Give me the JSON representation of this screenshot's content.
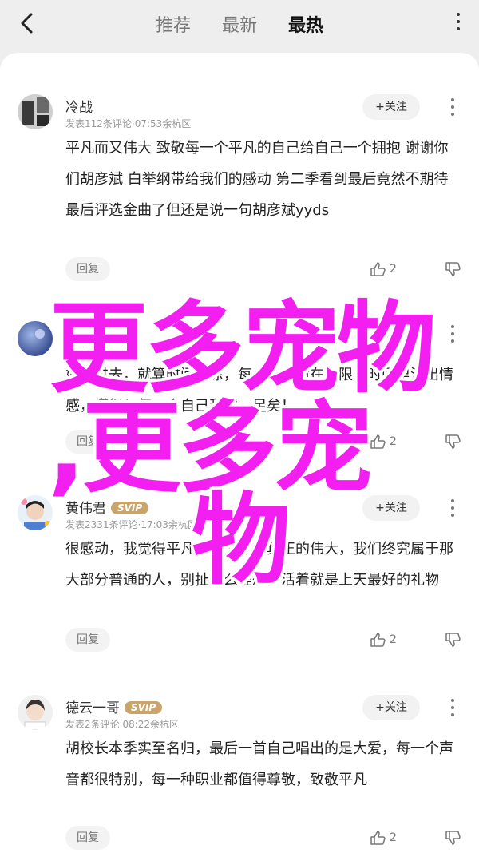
{
  "header": {
    "tabs": [
      {
        "label": "推荐"
      },
      {
        "label": "最新"
      },
      {
        "label": "最热"
      }
    ]
  },
  "comments": [
    {
      "name": "冷战",
      "vip": "",
      "meta": "发表112条评论·07:53余杭区",
      "follow": "+关注",
      "text": "平凡而又伟大  致敬每一个平凡的自己给自己一个拥抱 谢谢你们胡彦斌 白举纲带给我们的感动 第二季看到最后竟然不期待最后评选金曲了但还是说一句胡彦斌yyds",
      "reply": "回复",
      "likes": "2"
    },
    {
      "name": "",
      "vip": "",
      "meta": "发表",
      "follow": "+关注",
      "text": "如果过去，就算时间薄凉，每一个生命在有限的时间里活出情感，懂得与每一个自己和解～足矣！",
      "reply": "回复",
      "likes": "2"
    },
    {
      "name": "黄伟君",
      "vip": "SVIP",
      "meta": "发表2331条评论·17:03余杭区",
      "follow": "+关注",
      "text": "很感动，我觉得平凡的伟大才是真正的伟大，我们终究属于那大部分普通的人，别扯什么理想，活着就是上天最好的礼物",
      "reply": "回复",
      "likes": "2"
    },
    {
      "name": "德云一哥",
      "vip": "SVIP",
      "meta": "发表2条评论·08:22余杭区",
      "follow": "+关注",
      "text": "胡校长本季实至名归，最后一首自己唱出的是大爱，每一个声音都很特别，每一种职业都值得尊敬，致敬平凡",
      "reply": "回复",
      "likes": "2"
    }
  ],
  "overlay": {
    "line1": "更多宠物",
    "line2": ",更多宠",
    "line3": "物",
    "color": "#f21ff0"
  }
}
